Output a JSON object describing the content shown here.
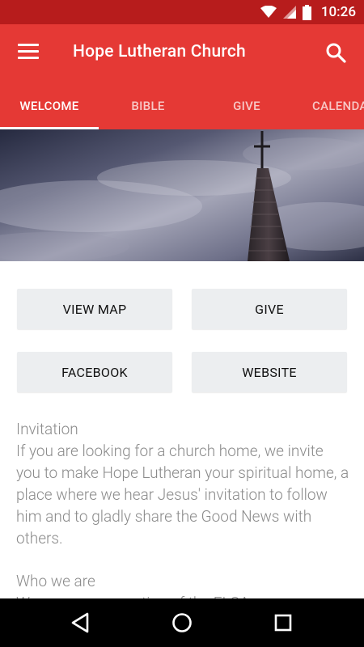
{
  "status_bar": {
    "time": "10:26"
  },
  "app_bar": {
    "title": "Hope Lutheran Church"
  },
  "tabs": [
    {
      "label": "WELCOME",
      "active": true
    },
    {
      "label": "BIBLE",
      "active": false
    },
    {
      "label": "GIVE",
      "active": false
    },
    {
      "label": "CALENDA",
      "active": false
    }
  ],
  "buttons": {
    "view_map": "VIEW MAP",
    "give": "GIVE",
    "facebook": "FACEBOOK",
    "website": "WEBSITE"
  },
  "content": {
    "invitation_heading": "Invitation",
    "invitation_body": "If you are looking for a church home, we invite you to make Hope Lutheran your spiritual home, a place where we hear Jesus' invitation to follow him and to gladly share the Good News with others.",
    "who_heading": "Who we are",
    "who_body_partial": "We are a congregation of the ELCA..."
  },
  "colors": {
    "primary": "#e53935",
    "primary_dark": "#b71c1c",
    "button_bg": "#eceef0",
    "body_text": "#8a8a8a"
  },
  "icons": {
    "menu": "hamburger-menu-icon",
    "search": "search-icon",
    "wifi": "wifi-icon",
    "signal": "signal-icon",
    "battery": "battery-icon",
    "back": "back-triangle-icon",
    "home": "home-circle-icon",
    "recents": "recents-square-icon"
  }
}
